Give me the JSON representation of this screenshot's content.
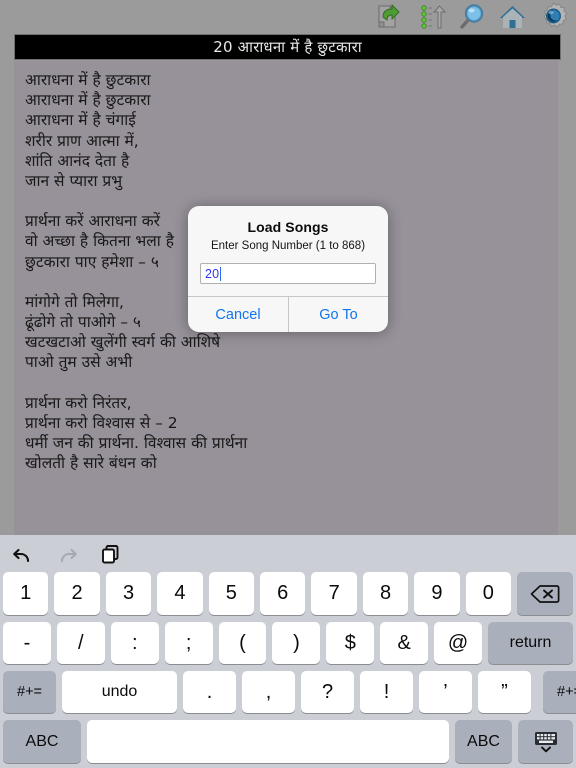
{
  "toolbar": {
    "icons": [
      {
        "name": "export-document-icon",
        "label": "Export"
      },
      {
        "name": "sort-list-up-icon",
        "label": "Sort"
      },
      {
        "name": "search-magnifier-icon",
        "label": "Search"
      },
      {
        "name": "home-icon",
        "label": "Home"
      },
      {
        "name": "settings-gear-icon",
        "label": "Settings"
      }
    ]
  },
  "titlebar": {
    "text": "20 आराधना में है छुटकारा"
  },
  "song": {
    "stanzas": [
      [
        "आराधना में है छुटकारा",
        "आराधना में है छुटकारा",
        "आराधना में है चंगाई",
        "शरीर प्राण आत्मा में,",
        "शांति आनंद देता है",
        "जान से प्यारा प्रभु"
      ],
      [
        "प्रार्थना करें आराधना करें",
        "वो अच्छा है कितना भला है",
        "छुटकारा पाए हमेशा – ५"
      ],
      [
        "मांगोगे तो मिलेगा,",
        "ढूंढोगे तो पाओगे – ५",
        "खटखटाओ खुलेंगी स्वर्ग की आशिषे",
        "पाओ तुम उसे अभी"
      ],
      [
        "प्रार्थना करो निरंतर,",
        "प्रार्थना करो विश्वास से – 2",
        "धर्मी जन की प्रार्थना. विश्वास की प्रार्थना",
        "खोलती है सारे बंधन को"
      ]
    ]
  },
  "dialog": {
    "title": "Load Songs",
    "subtitle": "Enter Song Number (1 to 868)",
    "input_value": "20",
    "input_placeholder": "",
    "cancel_label": "Cancel",
    "confirm_label": "Go To"
  },
  "keyboard": {
    "tools": [
      {
        "name": "undo-icon",
        "enabled": true
      },
      {
        "name": "redo-icon",
        "enabled": false
      },
      {
        "name": "paste-icon",
        "enabled": true
      }
    ],
    "row1": [
      "1",
      "2",
      "3",
      "4",
      "5",
      "6",
      "7",
      "8",
      "9",
      "0"
    ],
    "backspace": "⌫",
    "row2": [
      "-",
      "/",
      ":",
      ";",
      "(",
      ")",
      "$",
      "&",
      "@"
    ],
    "return_label": "return",
    "row3_left": "#+=",
    "row3": [
      "undo",
      ".",
      ",",
      "?",
      "!",
      "’",
      "”"
    ],
    "row3_right": "#+=",
    "row4_left": "ABC",
    "space_label": "",
    "row4_right": "ABC",
    "hide_keyboard": "keyboard-down-icon"
  },
  "colors": {
    "page_bg": "#9b9b9b",
    "content_bg": "#979199",
    "titlebar_bg": "#000000",
    "titlebar_fg": "#e8e8e8",
    "dialog_bg": "#f7f7f7",
    "dialog_accent": "#1174ef",
    "input_text": "#2f34f0",
    "keyboard_bg": "#ccced5",
    "key_bg": "#ffffff",
    "key_dark_bg": "#aab0bb"
  }
}
